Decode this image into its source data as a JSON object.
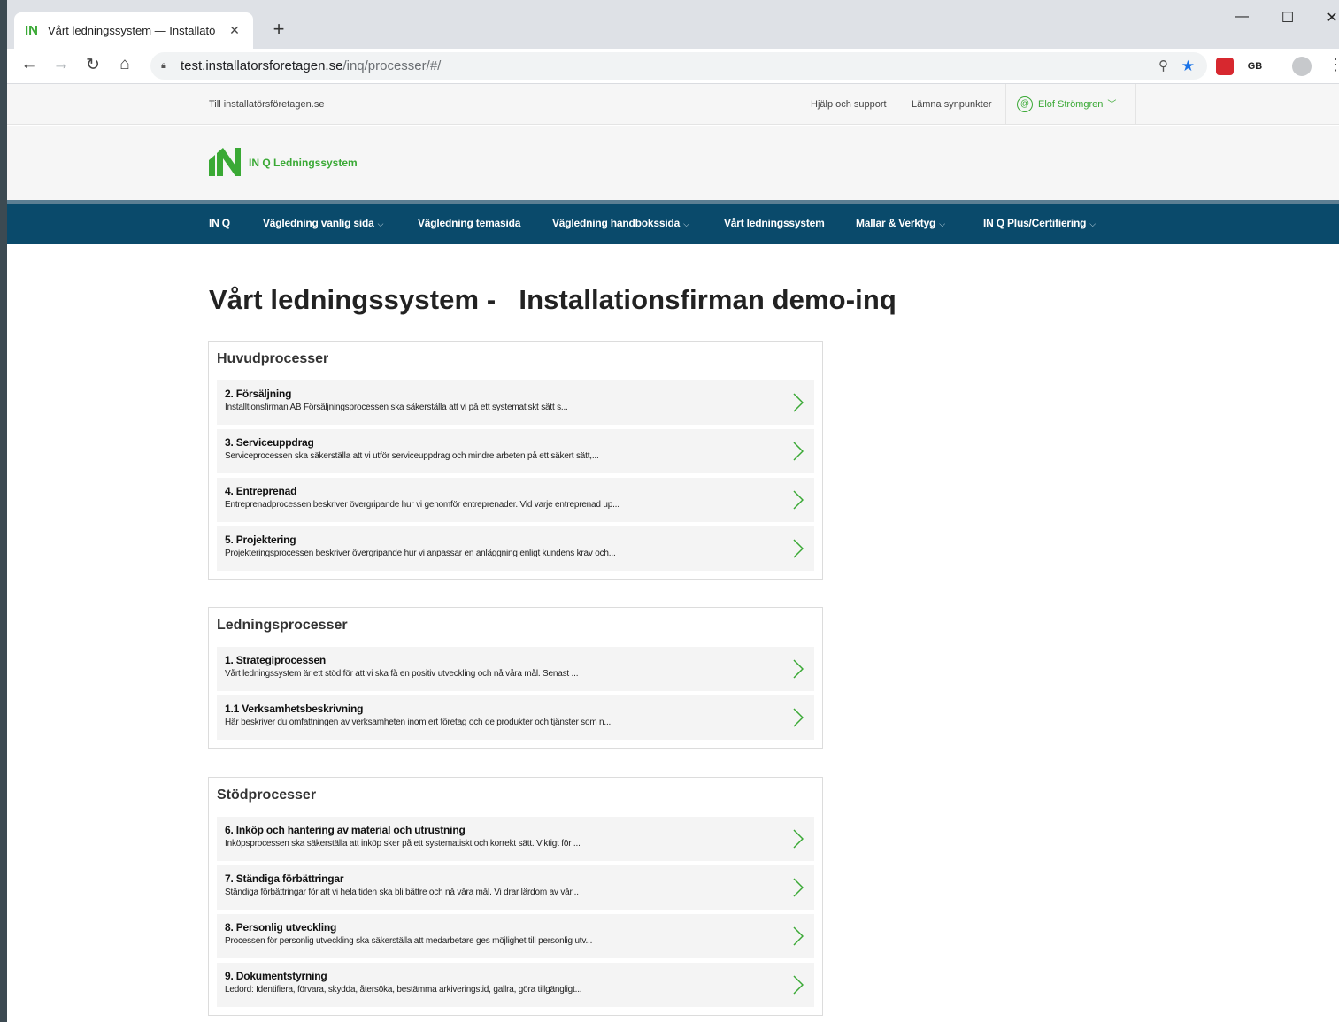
{
  "browser": {
    "tab_title": "Vårt ledningssystem — Installatö",
    "tab_favicon": "IN",
    "url_host": "test.installatorsforetagen.se",
    "url_path": "/inq/processer/#/"
  },
  "topbar": {
    "back_link": "Till installatörsföretagen.se",
    "help": "Hjälp och support",
    "feedback": "Lämna synpunkter",
    "user": "Elof Strömgren"
  },
  "brand": {
    "name": "IN Q Ledningssystem",
    "color": "#3aa935"
  },
  "nav": {
    "items": [
      {
        "label": "IN Q"
      },
      {
        "label": "Vägledning vanlig sida"
      },
      {
        "label": "Vägledning temasida"
      },
      {
        "label": "Vägledning handbokssida"
      },
      {
        "label": "Vårt ledningssystem"
      },
      {
        "label": "Mallar & Verktyg"
      },
      {
        "label": "IN Q Plus/Certifiering"
      }
    ]
  },
  "title": "Vårt ledningssystem -   Installationsfirman demo-inq",
  "groups": [
    {
      "heading": "Huvudprocesser",
      "rows": [
        {
          "title": "2. Försäljning",
          "desc": "Installtionsfirman AB  Försäljningsprocessen ska säkerställa att vi på ett systematiskt sätt s..."
        },
        {
          "title": "3. Serviceuppdrag",
          "desc": "Serviceprocessen ska säkerställa att vi utför serviceuppdrag och mindre arbeten på ett säkert sätt,..."
        },
        {
          "title": "4. Entreprenad",
          "desc": "Entreprenadprocessen beskriver övergripande hur vi genomför entreprenader. Vid varje entreprenad up..."
        },
        {
          "title": "5. Projektering",
          "desc": "Projekteringsprocessen beskriver övergripande hur vi anpassar en anläggning enligt kundens krav och..."
        }
      ]
    },
    {
      "heading": "Ledningsprocesser",
      "rows": [
        {
          "title": "1. Strategiprocessen",
          "desc": "Vårt ledningssystem är ett stöd för att vi ska få en positiv utveckling och nå våra mål. Senast ..."
        },
        {
          "title": "1.1 Verksamhetsbeskrivning",
          "desc": "Här beskriver du omfattningen av verksamheten inom ert företag och de produkter och tjänster som n..."
        }
      ]
    },
    {
      "heading": "Stödprocesser",
      "rows": [
        {
          "title": "6. Inköp och hantering av material och utrustning",
          "desc": "Inköpsprocessen ska säkerställa att inköp sker på ett systematiskt och korrekt sätt. Viktigt för ..."
        },
        {
          "title": "7. Ständiga förbättringar",
          "desc": "Ständiga förbättringar för att vi hela tiden ska bli bättre och nå våra mål. Vi drar lärdom av vår..."
        },
        {
          "title": "8. Personlig utveckling",
          "desc": "Processen för personlig utveckling ska säkerställa att medarbetare ges möjlighet till personlig utv..."
        },
        {
          "title": "9. Dokumentstyrning",
          "desc": "Ledord: Identifiera, förvara, skydda, återsöka, bestämma arkiveringstid, gallra, göra tillgängligt..."
        }
      ]
    }
  ]
}
